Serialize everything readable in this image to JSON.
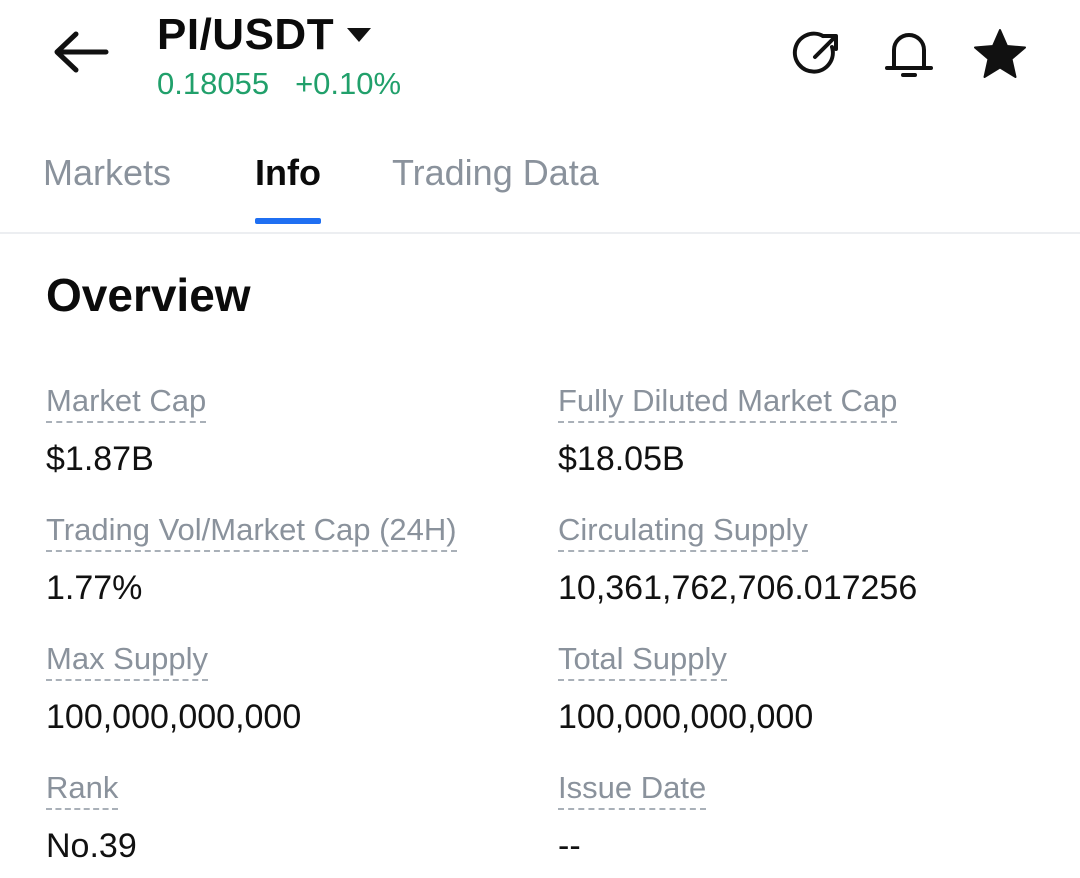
{
  "header": {
    "pair": "PI/USDT",
    "price": "0.18055",
    "change": "+0.10%",
    "icons": [
      "back-arrow-icon",
      "caret-down-icon",
      "share-icon",
      "bell-icon",
      "star-icon"
    ],
    "price_color": "#21a06b"
  },
  "tabs": [
    {
      "label": "Markets",
      "active": false
    },
    {
      "label": "Info",
      "active": true
    },
    {
      "label": "Trading Data",
      "active": false
    }
  ],
  "accent_color": "#1f6ff2",
  "overview": {
    "title": "Overview",
    "fields": [
      {
        "label": "Market Cap",
        "value": "$1.87B"
      },
      {
        "label": "Fully Diluted Market Cap",
        "value": "$18.05B"
      },
      {
        "label": "Trading Vol/Market Cap (24H)",
        "value": "1.77%"
      },
      {
        "label": "Circulating Supply",
        "value": "10,361,762,706.017256"
      },
      {
        "label": "Max Supply",
        "value": "100,000,000,000"
      },
      {
        "label": "Total Supply",
        "value": "100,000,000,000"
      },
      {
        "label": "Rank",
        "value": "No.39"
      },
      {
        "label": "Issue Date",
        "value": "--"
      }
    ]
  }
}
